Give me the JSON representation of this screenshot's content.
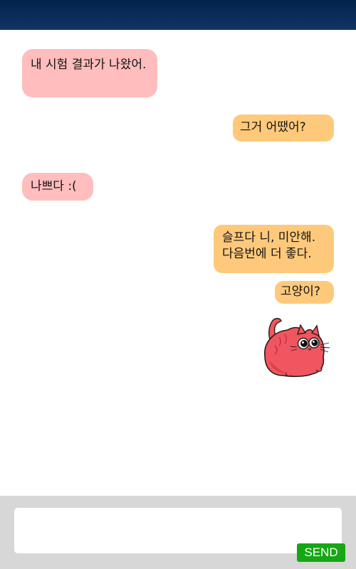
{
  "chat": {
    "messages": [
      {
        "from": "incoming",
        "text": "내 시험 결과가 나왔어."
      },
      {
        "from": "outgoing",
        "text": "그거 어땠어?"
      },
      {
        "from": "incoming",
        "text": "나쁘다 :("
      },
      {
        "from": "outgoing",
        "text": "슬프다 니, 미안해.\n다음번에 더 좋다."
      },
      {
        "from": "outgoing",
        "text": "고양이?"
      }
    ],
    "sticker": {
      "icon": "pink-cat-sticker"
    }
  },
  "composer": {
    "input_value": "",
    "send_label": "SEND"
  },
  "colors": {
    "topbar": "#0a2d5a",
    "incoming_bubble": "#ffbdbd",
    "outgoing_bubble": "#ffc97b",
    "composer_bg": "#d7d7d7",
    "send_button": "#17a614"
  }
}
